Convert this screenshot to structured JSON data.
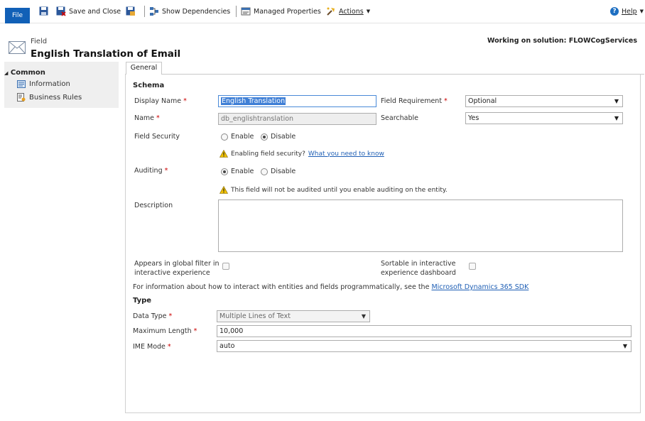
{
  "toolbar": {
    "file": "File",
    "save_close": "Save and Close",
    "show_dependencies": "Show Dependencies",
    "managed_properties": "Managed Properties",
    "actions": "Actions",
    "help": "Help"
  },
  "header": {
    "entity_type": "Field",
    "title": "English Translation of Email",
    "solution": "Working on solution: FLOWCogServices"
  },
  "nav": {
    "group": "Common",
    "items": [
      {
        "label": "Information"
      },
      {
        "label": "Business Rules"
      }
    ]
  },
  "tabs": [
    {
      "label": "General"
    }
  ],
  "schema": {
    "heading": "Schema",
    "display_name_label": "Display Name",
    "display_name_value": "English Translation",
    "field_requirement_label": "Field Requirement",
    "field_requirement_value": "Optional",
    "name_label": "Name",
    "name_value": "db_englishtranslation",
    "searchable_label": "Searchable",
    "searchable_value": "Yes",
    "field_security_label": "Field Security",
    "enable": "Enable",
    "disable": "Disable",
    "field_security_warning": "Enabling field security?",
    "field_security_link": "What you need to know",
    "auditing_label": "Auditing",
    "auditing_warning": "This field will not be audited until you enable auditing on the entity.",
    "description_label": "Description",
    "description_value": "",
    "global_filter_label_1": "Appears in global filter in",
    "global_filter_label_2": "interactive experience",
    "sortable_label_1": "Sortable in interactive",
    "sortable_label_2": "experience dashboard",
    "sdk_text": "For information about how to interact with entities and fields programmatically, see the",
    "sdk_link": "Microsoft Dynamics 365 SDK"
  },
  "type": {
    "heading": "Type",
    "data_type_label": "Data Type",
    "data_type_value": "Multiple Lines of Text",
    "max_length_label": "Maximum Length",
    "max_length_value": "10,000",
    "ime_mode_label": "IME Mode",
    "ime_mode_value": "auto"
  },
  "state": {
    "field_security": "Disable",
    "auditing": "Enable"
  },
  "colors": {
    "file_button": "#1160b7",
    "link": "#1f5fb5",
    "required": "#cc0000"
  }
}
